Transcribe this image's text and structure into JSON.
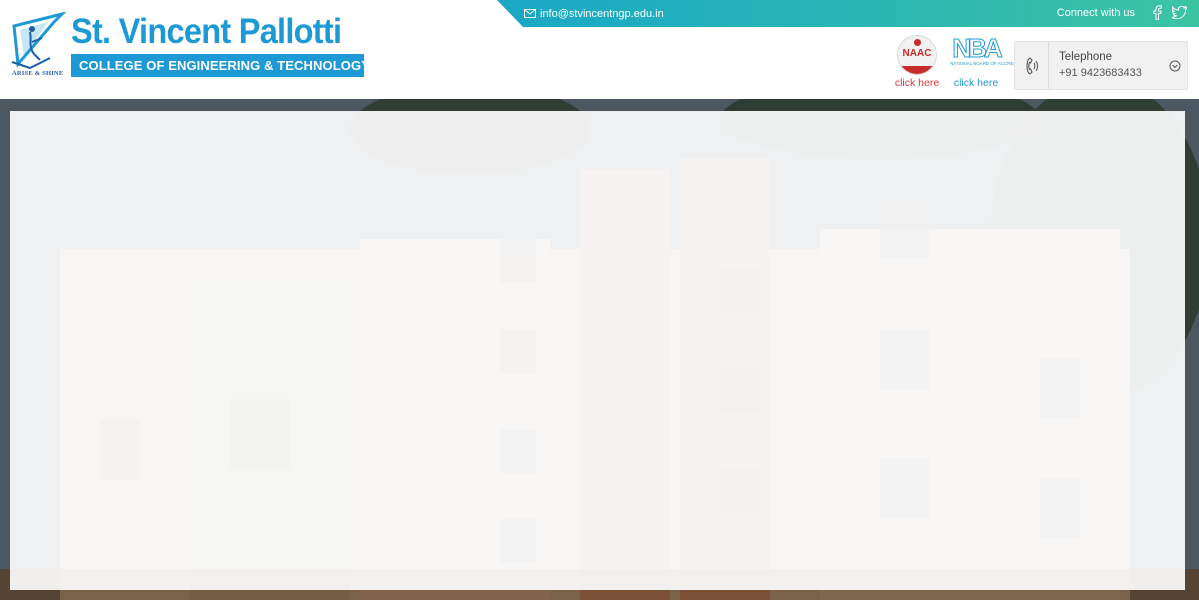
{
  "college": {
    "name": "St. Vincent Pallotti",
    "subtitle": "COLLEGE OF ENGINEERING & TECHNOLOGY",
    "tagline": "ARISE & SHINE"
  },
  "topbar": {
    "email": "info@stvincentngp.edu.in",
    "connect_label": "Connect with us",
    "social": [
      "facebook-icon",
      "twitter-icon"
    ]
  },
  "badges": {
    "naac": {
      "logo_text": "NAAC",
      "link": "click here"
    },
    "nba": {
      "logo_text": "NBA",
      "small_text": "NATIONAL BOARD OF ACCREDITATION",
      "link": "click here"
    }
  },
  "contact": {
    "label": "Telephone",
    "number": "+91 9423683433"
  },
  "colors": {
    "brand_blue": "#1d9ad6",
    "topbar_start": "#1aa7c6",
    "topbar_end": "#3cc4a2",
    "naac_red": "#c82b2b"
  }
}
